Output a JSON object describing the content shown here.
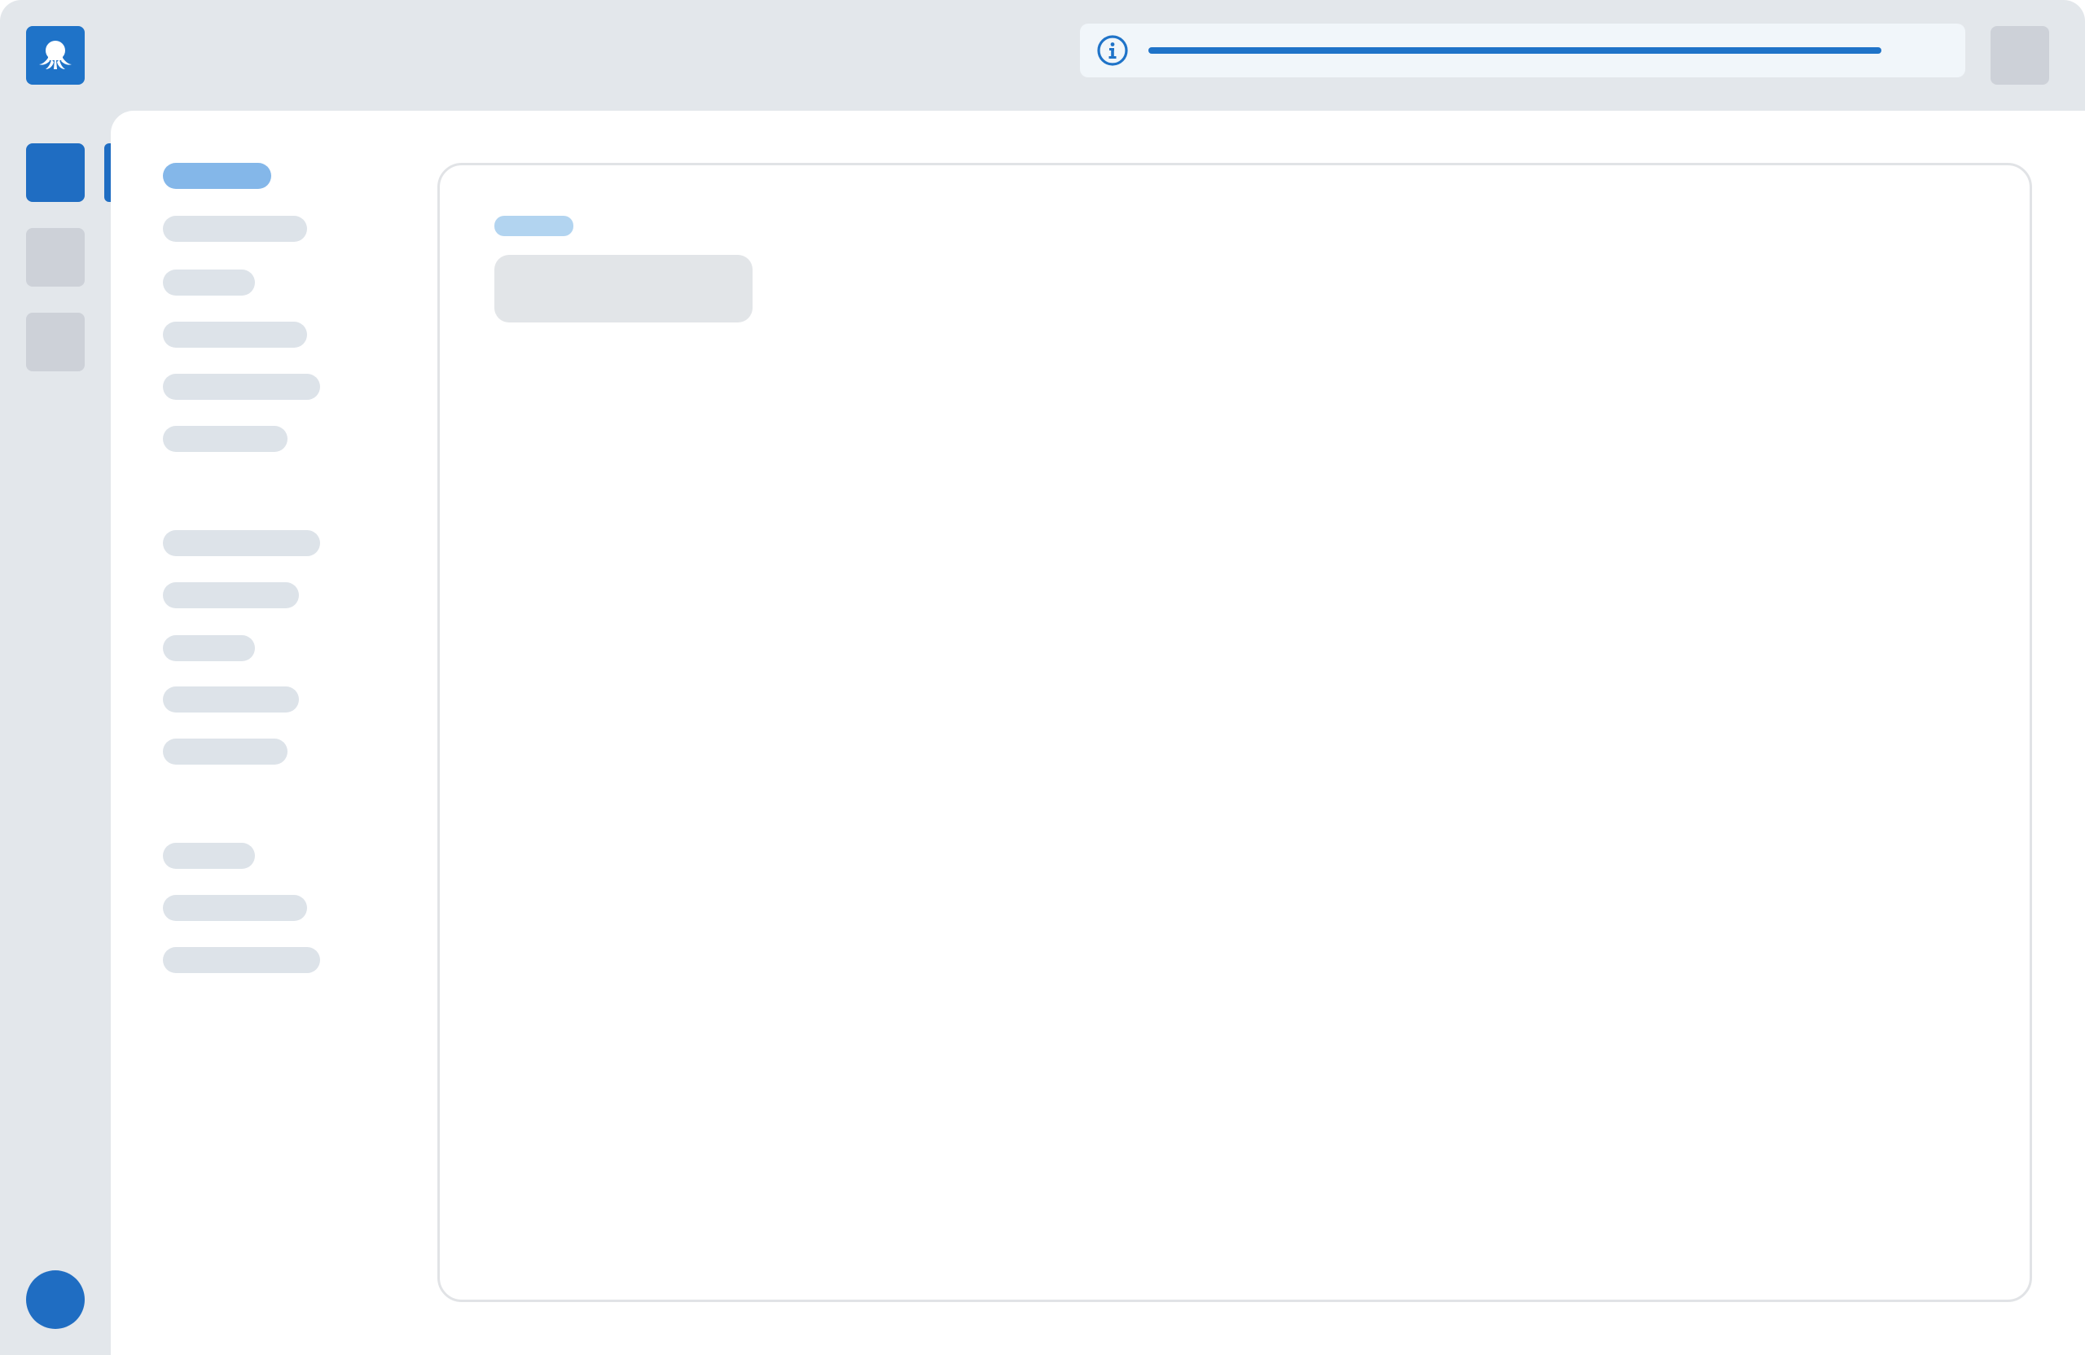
{
  "theme": {
    "accent": "#1f73c8",
    "chrome_background": "#e3e7eb",
    "placeholder": "#dde3e9",
    "active_placeholder": "#84b7e9"
  },
  "header": {
    "logo_icon": "octopus-logo-icon",
    "banner": {
      "icon": "info-icon",
      "progress": 1.0
    },
    "action_button": "placeholder-square"
  },
  "rail": {
    "items": [
      {
        "state": "active"
      },
      {
        "state": "inactive"
      },
      {
        "state": "inactive"
      }
    ],
    "avatar_icon": "user-avatar"
  },
  "sidebar": {
    "groups": [
      {
        "items": [
          {
            "state": "active"
          },
          {
            "state": "inactive"
          },
          {
            "state": "inactive"
          },
          {
            "state": "inactive"
          },
          {
            "state": "inactive"
          },
          {
            "state": "inactive"
          }
        ]
      },
      {
        "items": [
          {
            "state": "inactive"
          },
          {
            "state": "inactive"
          },
          {
            "state": "inactive"
          },
          {
            "state": "inactive"
          },
          {
            "state": "inactive"
          }
        ]
      },
      {
        "items": [
          {
            "state": "inactive"
          },
          {
            "state": "inactive"
          },
          {
            "state": "inactive"
          }
        ]
      }
    ]
  },
  "content": {
    "card": {
      "eyebrow": "placeholder",
      "title": "placeholder"
    }
  }
}
